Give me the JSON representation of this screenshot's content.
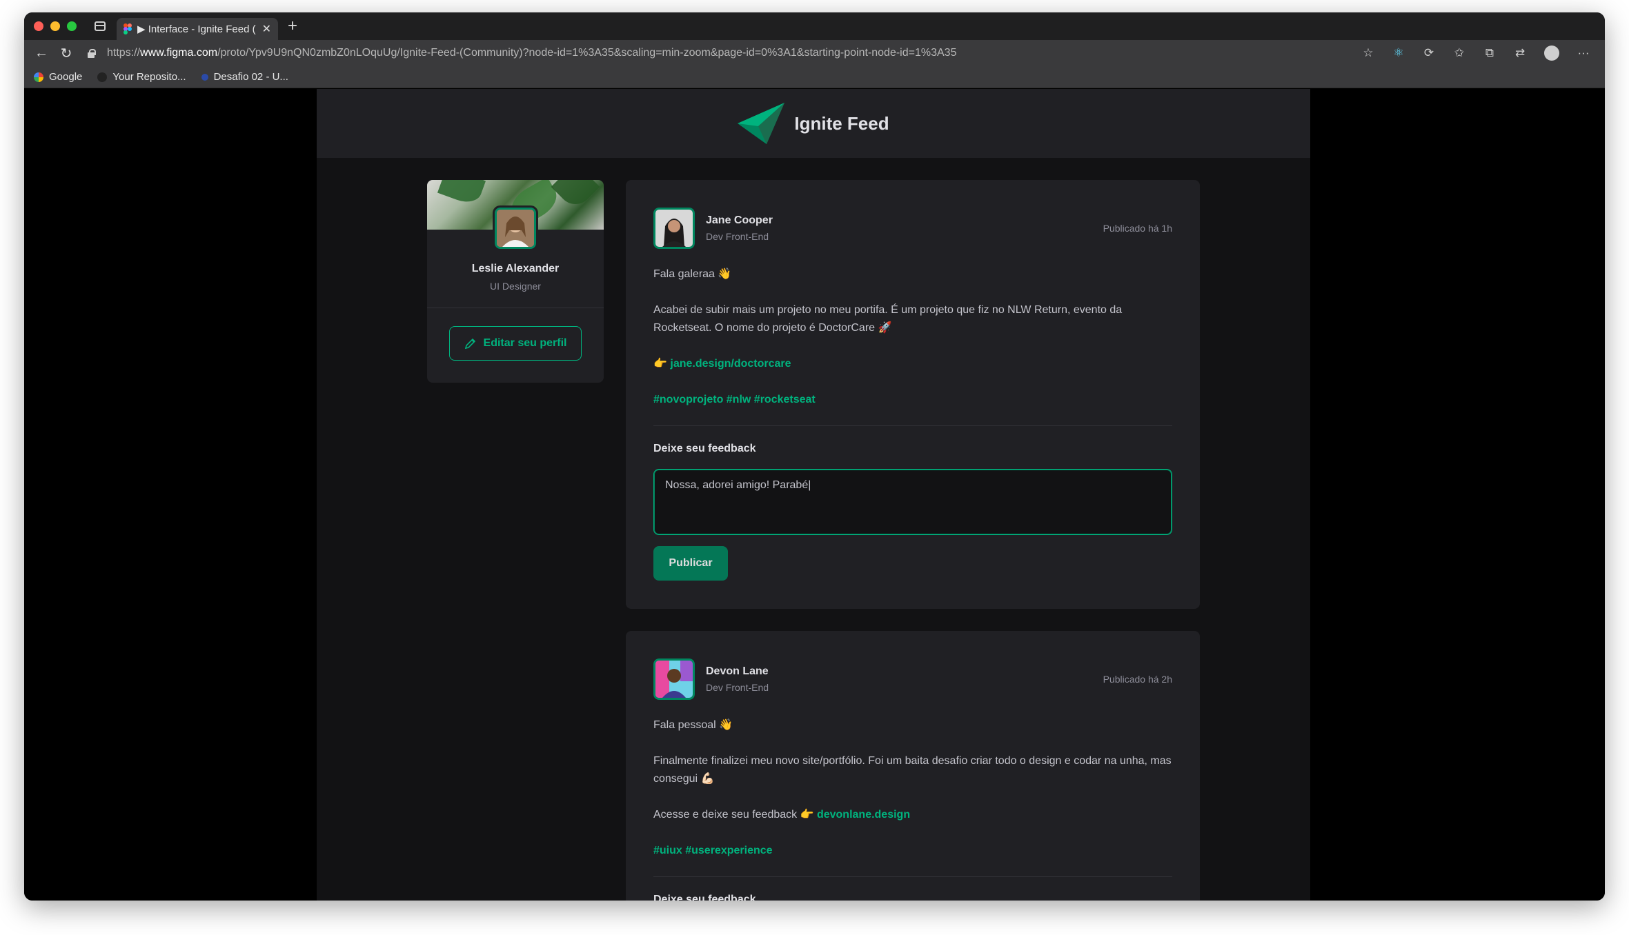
{
  "browser": {
    "tab_title": "▶ Interface - Ignite Feed (",
    "url_prefix": "https://",
    "url_host": "www.figma.com",
    "url_path": "/proto/Ypv9U9nQN0zmbZ0nLOquUg/Ignite-Feed-(Community)?node-id=1%3A35&scaling=min-zoom&page-id=0%3A1&starting-point-node-id=1%3A35",
    "bookmarks": [
      {
        "label": "Google"
      },
      {
        "label": "Your Reposito..."
      },
      {
        "label": "Desafio 02 - U..."
      }
    ]
  },
  "app": {
    "title": "Ignite Feed",
    "accent": "#00b37e",
    "accent_dark": "#00875f"
  },
  "profile": {
    "name": "Leslie Alexander",
    "role": "UI Designer",
    "edit_label": "Editar seu perfil"
  },
  "posts": [
    {
      "author": "Jane Cooper",
      "role": "Dev Front-End",
      "time": "Publicado há 1h",
      "greeting": "Fala galeraa 👋",
      "text": "Acabei de subir mais um projeto no meu portifa. É um projeto que fiz no NLW Return, evento da Rocketseat. O nome do projeto é DoctorCare 🚀",
      "link_prefix": "👉 ",
      "link": "jane.design/doctorcare",
      "tags": "#novoprojeto #nlw #rocketseat",
      "feedback_title": "Deixe seu feedback",
      "feedback_value": "Nossa, adorei amigo! Parabé|",
      "publish_label": "Publicar"
    },
    {
      "author": "Devon Lane",
      "role": "Dev Front-End",
      "time": "Publicado há 2h",
      "greeting": "Fala pessoal 👋",
      "text": "Finalmente finalizei meu novo site/portfólio. Foi um baita desafio criar todo o design e codar na unha, mas consegui 💪🏻",
      "link_prefix": "Acesse e deixe seu feedback 👉 ",
      "link": "devonlane.design",
      "tags": "#uiux #userexperience",
      "feedback_title": "Deixe seu feedback"
    }
  ]
}
